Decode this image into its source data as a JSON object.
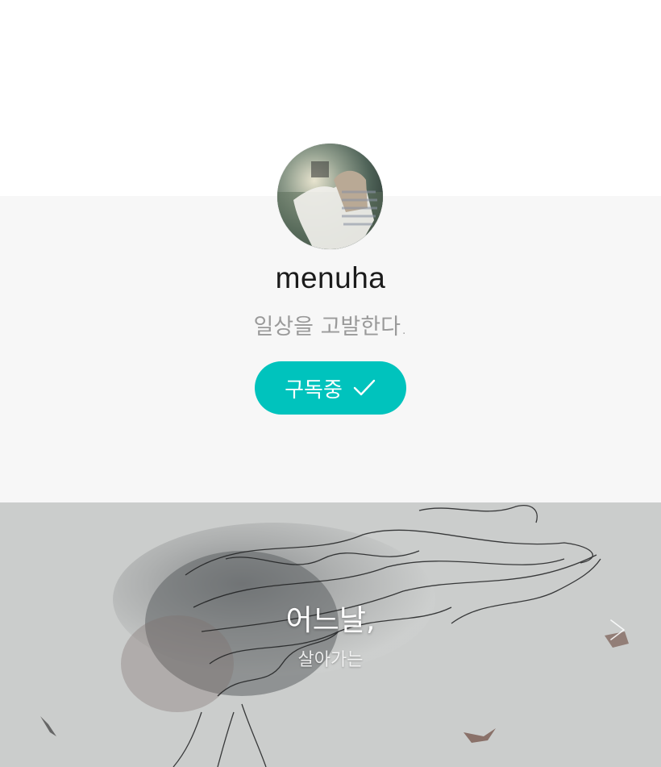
{
  "profile": {
    "name": "menuha",
    "tagline": "일상을 고발한다.",
    "subscribe_label": "구독중"
  },
  "cover": {
    "title": "어느날,",
    "subtitle": "살아가는"
  },
  "colors": {
    "accent": "#00c3bd",
    "profile_band": "#f7f7f7",
    "name_text": "#1b1b1b",
    "tagline_text": "#9a9a9a"
  },
  "icons": {
    "subscribe_state": "check-icon",
    "carousel_next": "chevron-right-icon"
  }
}
